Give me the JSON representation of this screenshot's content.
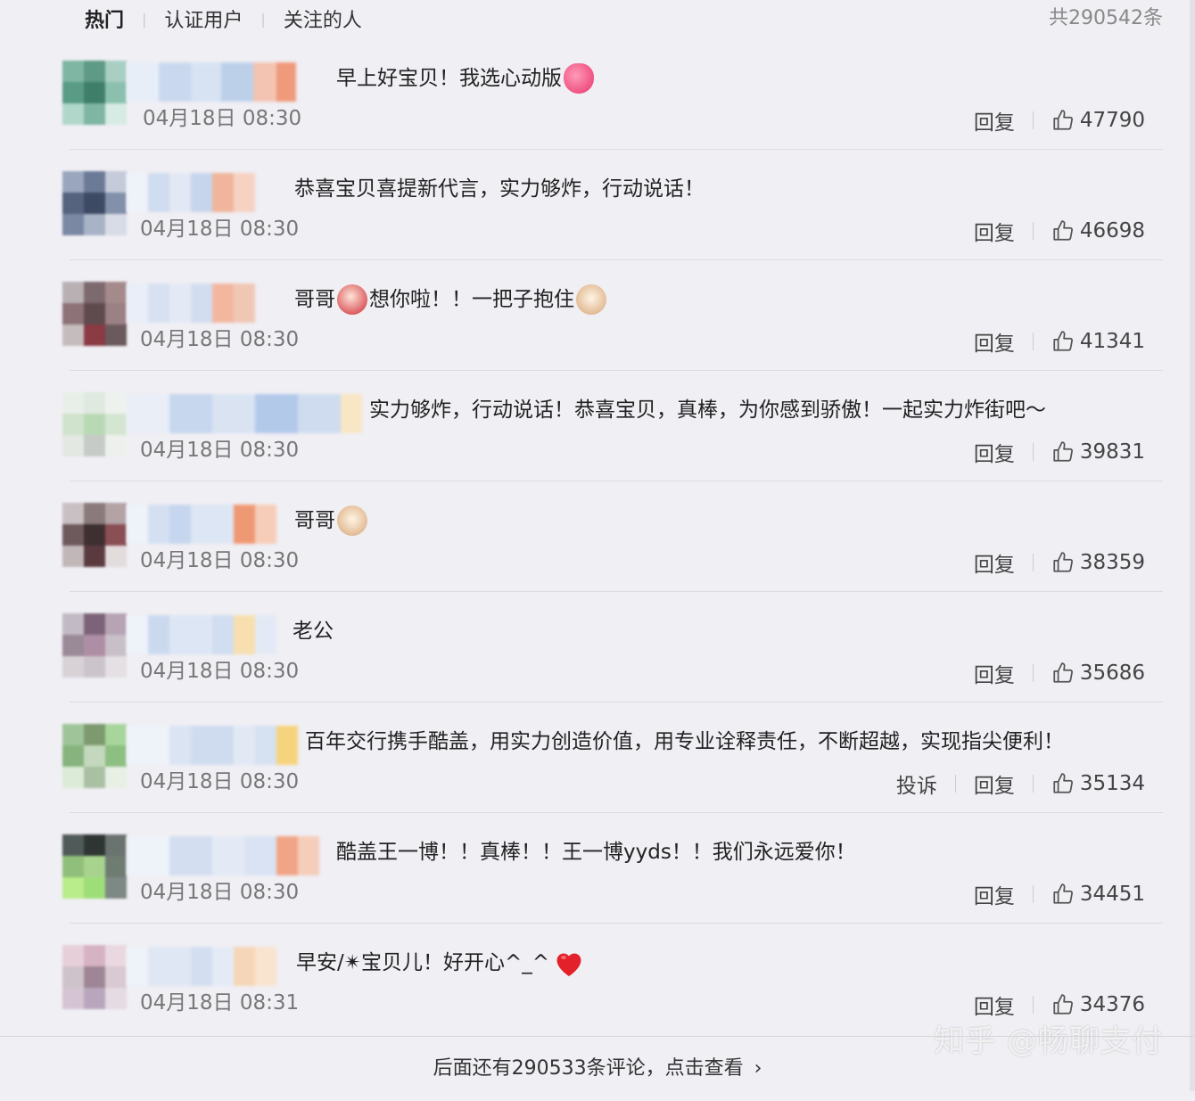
{
  "tabs": [
    {
      "label": "热门",
      "active": true
    },
    {
      "label": "认证用户",
      "active": false
    },
    {
      "label": "关注的人",
      "active": false
    }
  ],
  "total_count": "共290542条",
  "comments": [
    {
      "text_parts": [
        "早上好宝贝！我选心动版"
      ],
      "emojis": [
        "heart-pink-emoji"
      ],
      "timestamp": "04月18日 08:30",
      "reply_label": "回复",
      "likes": "47790",
      "avatar_colors": [
        "#7fb5a3",
        "#5e9a86",
        "#a9cfc3",
        "#5a9b86",
        "#3f7f6a",
        "#8cc0ae",
        "#b0d7ca",
        "#7fb5a3",
        "#d6ebe4"
      ],
      "name_colors": [
        "#e8eef8",
        "#c9d8ee",
        "#d7e3f3",
        "#bcd0ea",
        "#f3c4b1",
        "#ef9a7b"
      ]
    },
    {
      "text_parts": [
        "恭喜宝贝喜提新代言，实力够炸，行动说话！"
      ],
      "emojis": [],
      "timestamp": "04月18日 08:30",
      "reply_label": "回复",
      "likes": "46698",
      "avatar_colors": [
        "#9aa6bd",
        "#6b7a97",
        "#c5cbd9",
        "#55637f",
        "#3d4a63",
        "#8390aa",
        "#7a88a3",
        "#a9b3c7",
        "#d8dce6"
      ],
      "name_colors": [
        "#eef2f9",
        "#d0dcef",
        "#e2e8f4",
        "#c7d5ec",
        "#f1b59c",
        "#f6d2c2"
      ]
    },
    {
      "text_parts": [
        "哥哥",
        "想你啦！！一把子抱住"
      ],
      "emojis": [
        "face-red-emoji",
        "face-dog-emoji"
      ],
      "timestamp": "04月18日 08:30",
      "reply_label": "回复",
      "likes": "41341",
      "avatar_colors": [
        "#b9b0b3",
        "#7d6a6e",
        "#a58a8c",
        "#8d7377",
        "#5f4a4e",
        "#9b8084",
        "#c5bcbe",
        "#8a3b44",
        "#6a5a5d"
      ],
      "name_colors": [
        "#e9eef8",
        "#d7e1f2",
        "#e4eaf5",
        "#d2ddf0",
        "#f3b79f",
        "#f0c7b5"
      ]
    },
    {
      "text_parts": [
        "实力够炸，行动说话！恭喜宝贝，真棒，为你感到骄傲！一起实力炸街吧～"
      ],
      "emojis": [],
      "timestamp": "04月18日 08:30",
      "reply_label": "回复",
      "likes": "39831",
      "avatar_colors": [
        "#e8efe8",
        "#dfe9df",
        "#eef2ee",
        "#cfe3cd",
        "#b9d9b5",
        "#d4e6d2",
        "#e3e8e3",
        "#c7cbc7",
        "#eef0ee"
      ],
      "name_colors": [
        "#e9eef7",
        "#c7d7ee",
        "#d9e3f2",
        "#b3c9ea",
        "#cfdcef",
        "#f8e6c5"
      ]
    },
    {
      "text_parts": [
        "哥哥"
      ],
      "emojis": [
        "face-dog-emoji"
      ],
      "timestamp": "04月18日 08:30",
      "reply_label": "回复",
      "likes": "38359",
      "avatar_colors": [
        "#c8c0c2",
        "#8a7a7c",
        "#b3a3a5",
        "#6e5a5c",
        "#3e2f31",
        "#8a4f55",
        "#c1b7b9",
        "#5b3a3f",
        "#e2dcdd"
      ],
      "name_colors": [
        "#eef2f9",
        "#d4e0f2",
        "#c6d6ee",
        "#dde6f4",
        "#ef9874",
        "#f6cdb9"
      ]
    },
    {
      "text_parts": [
        "老公"
      ],
      "emojis": [],
      "timestamp": "04月18日 08:30",
      "reply_label": "回复",
      "likes": "35686",
      "avatar_colors": [
        "#c2bac4",
        "#7d6379",
        "#b6a3b3",
        "#9a8a98",
        "#ae8ea4",
        "#c9bfc8",
        "#d8d2d7",
        "#cbc4ca",
        "#e4e0e3"
      ],
      "name_colors": [
        "#eef2f9",
        "#cbd9ef",
        "#dde6f4",
        "#d1ddf0",
        "#f7dfb0",
        "#e3eaf5"
      ]
    },
    {
      "text_parts": [
        "百年交行携手酷盖，用实力创造价值，用专业诠释责任，不断超越，实现指尖便利！"
      ],
      "emojis": [],
      "timestamp": "04月18日 08:30",
      "complaint_label": "投诉",
      "reply_label": "回复",
      "likes": "35134",
      "avatar_colors": [
        "#9fc49a",
        "#7d9a6f",
        "#a8d59b",
        "#87b47e",
        "#c3d8bc",
        "#8dbf82",
        "#dcebd7",
        "#a9c0a3",
        "#e8f0e6"
      ],
      "name_colors": [
        "#eef2f9",
        "#dbe4f3",
        "#cfdcf0",
        "#e2e9f5",
        "#d6e1f2",
        "#f6d37d"
      ]
    },
    {
      "text_parts": [
        "酷盖王一博！！真棒！！王一博yyds！！我们永远爱你！"
      ],
      "emojis": [],
      "timestamp": "04月18日 08:30",
      "reply_label": "回复",
      "likes": "34451",
      "avatar_colors": [
        "#505a58",
        "#2f3533",
        "#6b7370",
        "#8fbf7a",
        "#a8d38f",
        "#6f7c72",
        "#b9ec8a",
        "#9ede79",
        "#7e8884"
      ],
      "name_colors": [
        "#eef2f9",
        "#d3def1",
        "#e4eaf5",
        "#d9e3f3",
        "#f1a486",
        "#f5cdbb"
      ]
    },
    {
      "text_parts": [
        "早安/✴宝贝儿！好开心^_^"
      ],
      "emojis": [
        "heart-red-emoji"
      ],
      "timestamp": "04月18日 08:31",
      "reply_label": "回复",
      "likes": "34376",
      "avatar_colors": [
        "#e6cfd9",
        "#d6b3c3",
        "#ead8e0",
        "#cfc3cb",
        "#9e8696",
        "#d9c9d2",
        "#d5c4d3",
        "#b9a6bd",
        "#e5dbe3"
      ],
      "name_colors": [
        "#eef2f9",
        "#dfe7f4",
        "#d3def1",
        "#e5ebf6",
        "#f6d6b8",
        "#f9e4cf"
      ]
    }
  ],
  "more_comments": "后面还有290533条评论，点击查看",
  "more_chevron": "›",
  "watermark": "知乎 @畅聊支付"
}
